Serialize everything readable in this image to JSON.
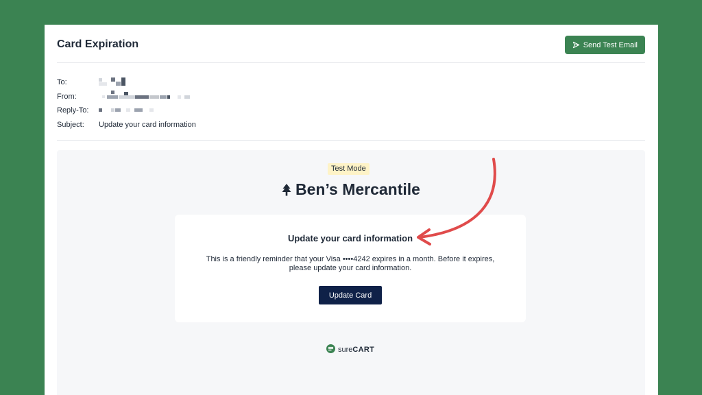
{
  "header": {
    "title": "Card Expiration",
    "send_button_label": "Send Test Email"
  },
  "meta": {
    "to_label": "To:",
    "from_label": "From:",
    "reply_to_label": "Reply-To:",
    "subject_label": "Subject:",
    "subject_value": "Update your card information"
  },
  "preview": {
    "badge": "Test Mode",
    "brand_name": "Ben’s Mercantile",
    "card_title": "Update your card information",
    "card_body": "This is a friendly reminder that your Visa ••••4242 expires in a month. Before it expires, please update your card information.",
    "button_label": "Update Card",
    "footer_logo_sure": "sure",
    "footer_logo_cart": "CART"
  },
  "colors": {
    "background": "#3b8352",
    "accent": "#3b8352",
    "primary_button": "#0f2148",
    "badge": "#fef3c7",
    "arrow": "#e04b4b"
  },
  "icons": {
    "send": "send-icon",
    "tree": "tree-icon",
    "surecart": "surecart-logo-icon"
  }
}
